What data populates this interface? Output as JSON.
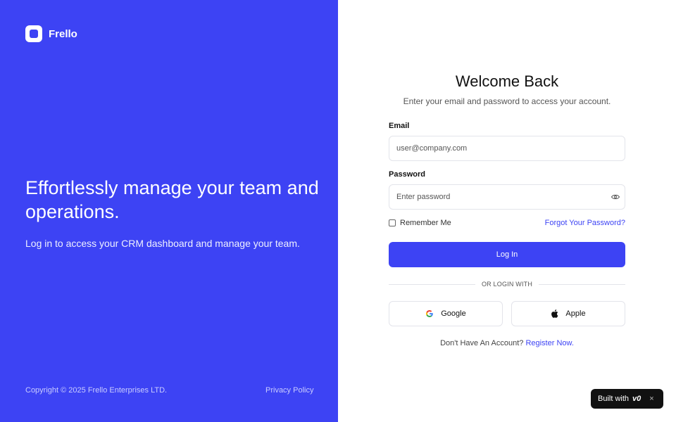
{
  "brand": {
    "name": "Frello",
    "accent": "#3d43f4"
  },
  "hero": {
    "title": "Effortlessly manage your team and operations.",
    "subtitle": "Log in to access your CRM dashboard and manage your team."
  },
  "footer": {
    "copyright": "Copyright © 2025 Frello Enterprises LTD.",
    "privacy": "Privacy Policy"
  },
  "form": {
    "title": "Welcome Back",
    "subtitle": "Enter your email and password to access your account.",
    "email": {
      "label": "Email",
      "placeholder": "user@company.com",
      "value": ""
    },
    "password": {
      "label": "Password",
      "placeholder": "Enter password",
      "value": "",
      "toggle_icon": "eye-icon"
    },
    "remember_label": "Remember Me",
    "forgot_label": "Forgot Your Password?",
    "login_label": "Log In",
    "divider_text": "OR LOGIN WITH",
    "social": [
      {
        "label": "Google",
        "icon": "google-icon"
      },
      {
        "label": "Apple",
        "icon": "apple-icon"
      }
    ],
    "register_prompt": "Don't Have An Account?",
    "register_link": "Register Now."
  },
  "badge": {
    "label": "Built with",
    "logo": "v0",
    "close": "×"
  }
}
